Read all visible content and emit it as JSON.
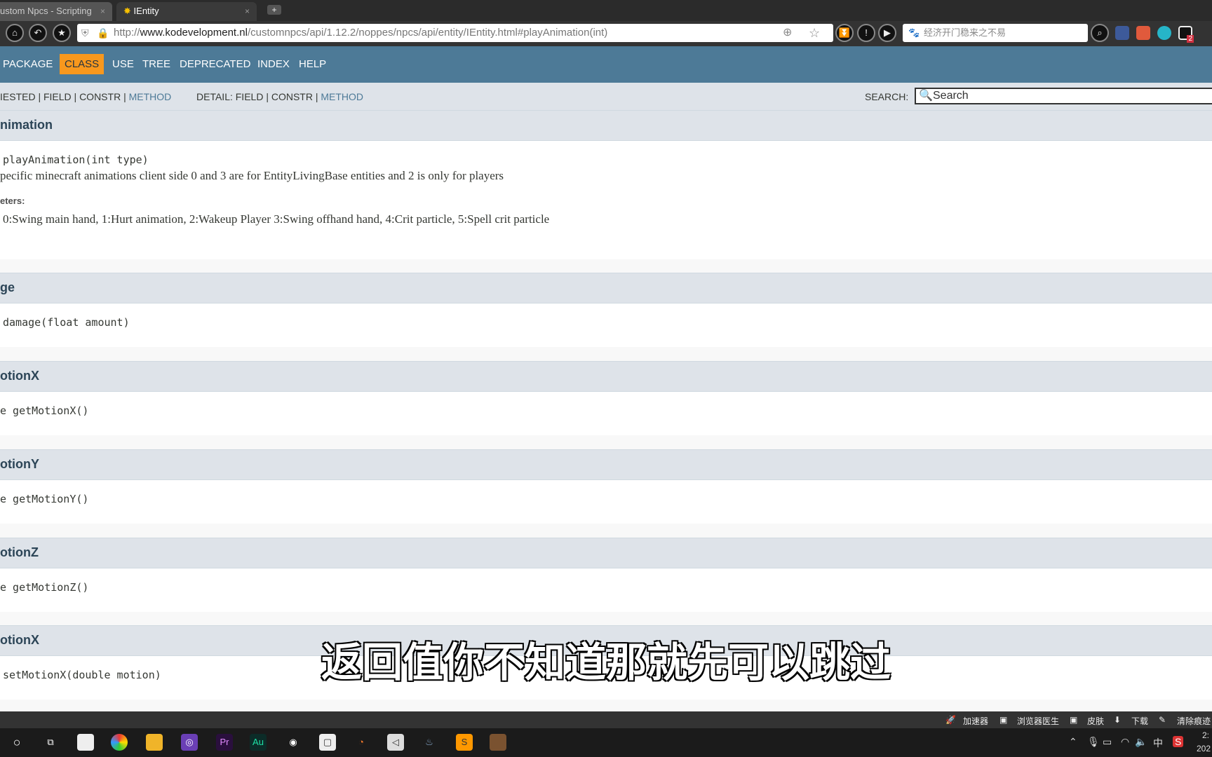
{
  "browser": {
    "tabs": [
      {
        "label": "ustom Npcs - Scripting"
      },
      {
        "label": "IEntity",
        "icon": "bug-icon"
      }
    ],
    "url_prefix": "http://",
    "url_domain": "www.kodevelopment.nl",
    "url_path": "/customnpcs/api/1.12.2/noppes/npcs/api/entity/IEntity.html#playAnimation(int)",
    "search_placeholder": "经济开门稳来之不易",
    "ext_badge": "2"
  },
  "nav": {
    "items": [
      "PACKAGE",
      "CLASS",
      "USE",
      "TREE",
      "DEPRECATED",
      "INDEX",
      "HELP"
    ],
    "active": "CLASS"
  },
  "subnav": {
    "summary_prefix": "IESTED | FIELD | CONSTR | ",
    "summary_method": "METHOD",
    "detail_prefix": "DETAIL: FIELD | CONSTR | ",
    "detail_method": "METHOD",
    "search_label": "SEARCH:",
    "search_placeholder": "Search"
  },
  "sections": [
    {
      "title": "nimation",
      "signature": "playAnimation(int  type)",
      "description": "pecific minecraft animations client side 0 and 3 are for EntityLivingBase entities and 2 is only for players",
      "param_label": "eters:",
      "param_text": "0:Swing main hand, 1:Hurt animation, 2:Wakeup Player 3:Swing offhand hand, 4:Crit particle, 5:Spell crit particle"
    },
    {
      "title": "ge",
      "signature": "damage(float  amount)"
    },
    {
      "title": "otionX",
      "signature": "e  getMotionX()"
    },
    {
      "title": "otionY",
      "signature": "e  getMotionY()"
    },
    {
      "title": "otionZ",
      "signature": "e  getMotionZ()"
    },
    {
      "title": "otionX",
      "signature": "setMotionX(double  motion)"
    }
  ],
  "statusbar": [
    "加速器",
    "浏览器医生",
    "皮肤",
    "下载",
    "清除痕迹"
  ],
  "tray": {
    "ime": "中",
    "time": "2:",
    "date": "202"
  },
  "subtitle": "返回值你不知道那就先可以跳过",
  "colors": {
    "nav": "#4d7a97",
    "active": "#f8981d",
    "header": "#dee3e9"
  }
}
